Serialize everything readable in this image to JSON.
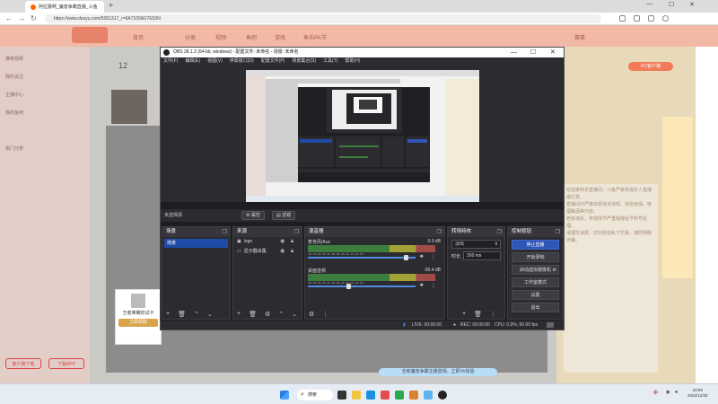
{
  "browser": {
    "tab_title": "阿拉蕾啊_魔兽争霸直播_斗鱼",
    "url": "https://www.douyu.com/5051317_r=0A7105MJ7E53N"
  },
  "douyu": {
    "nav": [
      "首页",
      "分类",
      "视频",
      "鱼吧",
      "游戏",
      "赛事",
      "鱼乐PK节"
    ],
    "viewer_count": "12",
    "sidebar_items": [
      "推荐视频",
      "我的关注",
      "主播中心",
      "我的鱼吧",
      "热门分类"
    ],
    "sidebar_buttons": [
      "客户端下载",
      "下载APP"
    ],
    "pc_button": "PC客户端",
    "game_card": {
      "title": "王者荣耀初试卡",
      "button": "立即领取"
    },
    "promo_text": "全新魔兽争霸主播登场，立即Vo体验",
    "chat_lines": [
      "欢迎来到本直播间，斗鱼严禁未成年人直播或打赏。",
      "直播间内严禁出现违法违规、低俗色情、吸烟酗酒等内容。",
      "若有违反，将视情节严重程度给予封号处理。",
      "请理性消费，切勿轻信私下交易，谨防网络诈骗。"
    ]
  },
  "obs": {
    "title": "OBS 28.1.2 (64-bit, windows) - 配置文件: 未命名 - 场景: 未命名",
    "menu": [
      "文件(F)",
      "编辑(E)",
      "视图(V)",
      "停靠窗口(D)",
      "配置文件(P)",
      "场景集合(S)",
      "工具(T)",
      "帮助(H)"
    ],
    "scenebar": {
      "label": "未选择源",
      "properties": "属性",
      "filters": "滤镜"
    },
    "docks": {
      "scenes": {
        "title": "场景",
        "items": [
          "场景"
        ]
      },
      "sources": {
        "title": "来源",
        "items": [
          {
            "icon": "image-icon",
            "name": "logo"
          },
          {
            "icon": "monitor-icon",
            "name": "显示器采集"
          }
        ]
      },
      "mixer": {
        "title": "混音器",
        "channels": [
          {
            "name": "麦克风/Aux",
            "db": "0.0 dB",
            "volume": 0.93
          },
          {
            "name": "桌面音频",
            "db": "-26.4 dB",
            "volume": 0.37
          }
        ],
        "ticks": "-60 -55 -50 -45 -40 -35 -30 -25 -20 -15 -10 -5 0"
      },
      "transitions": {
        "title": "转场特效",
        "selected": "淡出",
        "duration_label": "时长",
        "duration_value": "300 ms"
      },
      "controls": {
        "title": "控制按钮",
        "buttons": [
          "停止直播",
          "开始录制",
          "启动虚拟摄像机",
          "工作室模式",
          "设置",
          "退出"
        ]
      }
    },
    "status": {
      "live": "LIVE: 00:00:00",
      "rec": "REC: 00:00:00",
      "cpu": "CPU: 0.9%, 60.00 fps"
    }
  },
  "taskbar": {
    "search": "搜索",
    "ime": "中",
    "clock_time": "19:09",
    "clock_date": "2022/12/25"
  },
  "colors": {
    "accent_blue": "#2f56b5",
    "obs_bg": "#1e1e22",
    "douyu_orange": "#f27a58"
  }
}
